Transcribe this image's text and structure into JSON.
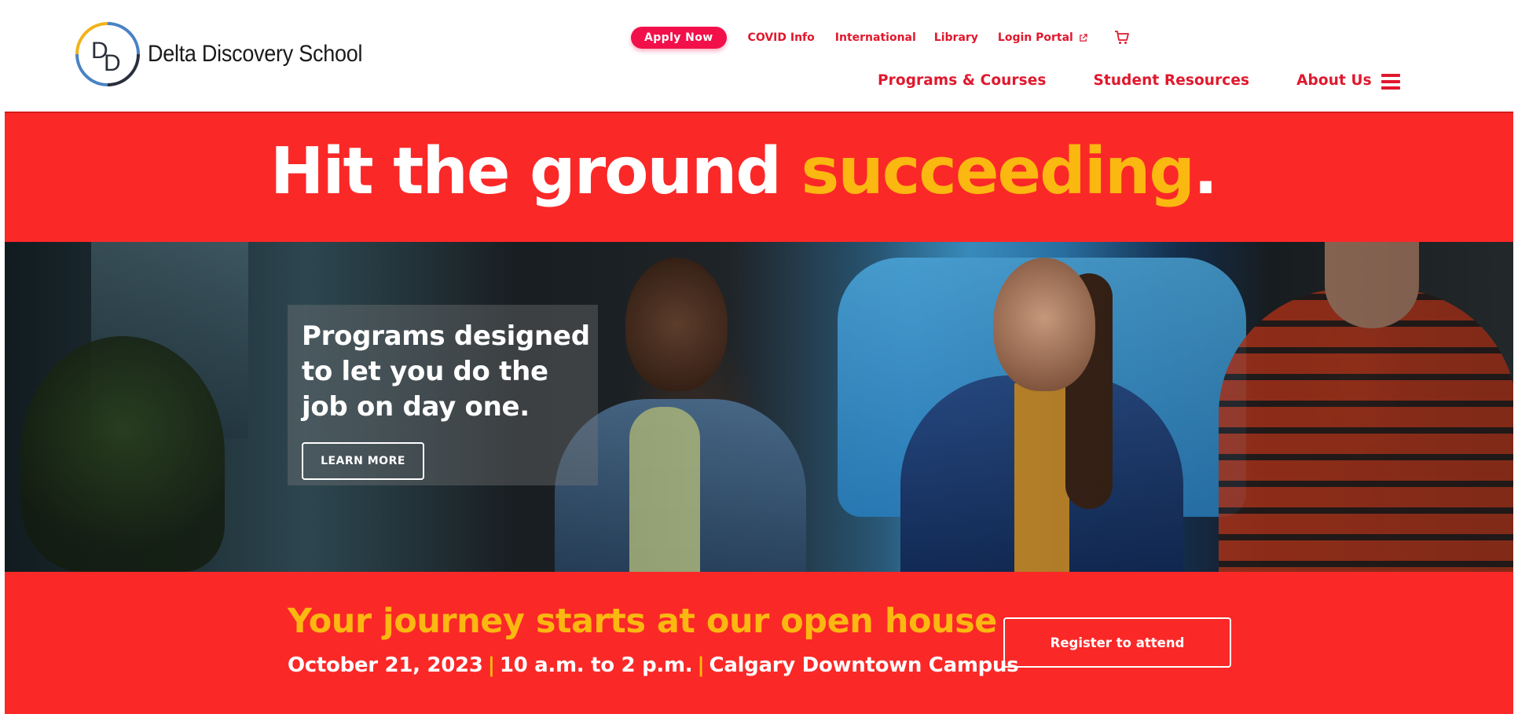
{
  "brand": {
    "name": "Delta Discovery School",
    "colors": {
      "primary_red": "#fb2828",
      "accent_yellow": "#fbb810",
      "link_red": "#e0182d",
      "apply_pink": "#f2104a"
    }
  },
  "utility_nav": {
    "apply_label": "Apply Now",
    "links": [
      "COVID Info",
      "International",
      "Library",
      "Login Portal"
    ],
    "login_icon": "external-link-icon",
    "cart_icon": "shopping-cart-icon"
  },
  "main_nav": {
    "items": [
      "Programs & Courses",
      "Student Resources",
      "About Us"
    ],
    "menu_icon": "hamburger-menu-icon"
  },
  "hero": {
    "title_part1": "Hit the ground",
    "title_accent": "succeeding",
    "title_end": "."
  },
  "promo": {
    "heading": "Programs designed to let you do the job on day one.",
    "button_label": "LEARN MORE"
  },
  "open_house": {
    "title": "Your journey starts at our open house",
    "date": "October 21, 2023",
    "separator": "|",
    "time": "10 a.m. to 2 p.m.",
    "location": "Calgary Downtown Campus",
    "button_label": "Register to attend"
  }
}
